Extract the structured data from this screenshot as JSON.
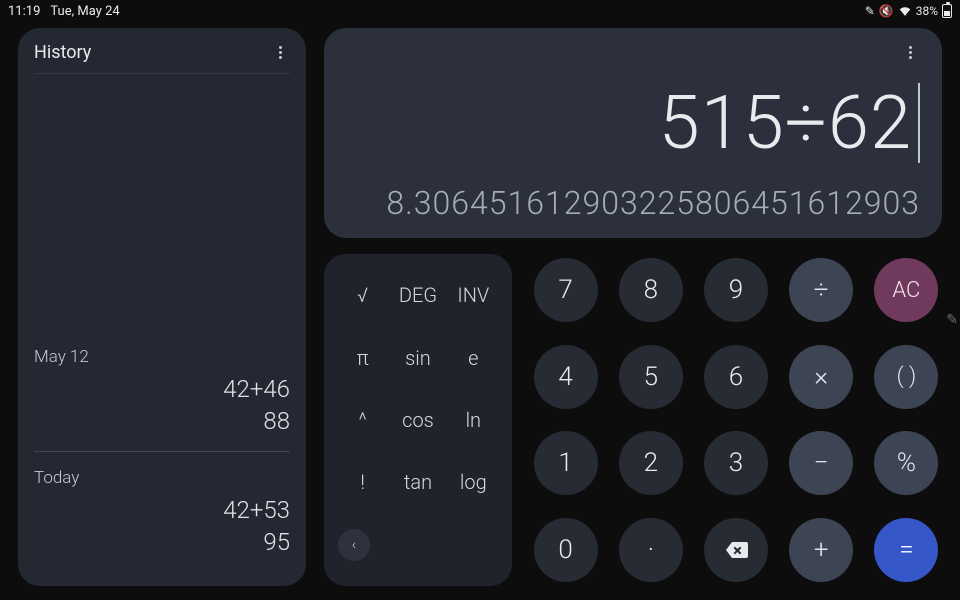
{
  "status": {
    "time": "11:19",
    "date": "Tue, May 24",
    "battery_pct": "38%"
  },
  "history": {
    "title": "History",
    "sections": [
      {
        "label": "May 12",
        "expression": "42+46",
        "result": "88"
      },
      {
        "label": "Today",
        "expression": "42+53",
        "result": "95"
      }
    ]
  },
  "display": {
    "expression": "515÷62",
    "result": "8.306451612903225806451612903"
  },
  "sci": {
    "r0c0": "√",
    "r0c1": "DEG",
    "r0c2": "INV",
    "r1c0": "π",
    "r1c1": "sin",
    "r1c2": "e",
    "r2c0": "^",
    "r2c1": "cos",
    "r2c2": "ln",
    "r3c0": "!",
    "r3c1": "tan",
    "r3c2": "log",
    "collapse": "‹"
  },
  "keys": {
    "k7": "7",
    "k8": "8",
    "k9": "9",
    "div": "÷",
    "ac": "AC",
    "k4": "4",
    "k5": "5",
    "k6": "6",
    "mul": "×",
    "par": "( )",
    "k1": "1",
    "k2": "2",
    "k3": "3",
    "sub": "−",
    "pct": "%",
    "k0": "0",
    "dot": "·",
    "del": "⌫",
    "add": "+",
    "eq": "="
  }
}
